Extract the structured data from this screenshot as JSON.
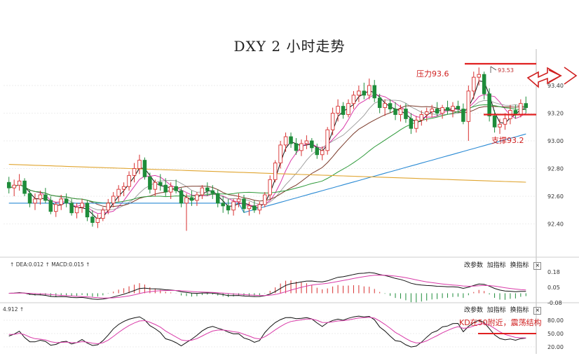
{
  "title": "DXY 2 小时走势",
  "colors": {
    "up": "#d83030",
    "down": "#1e8c3a",
    "ma_fast": "#111111",
    "ma_pink": "#d93aa8",
    "ma_gray": "#999999",
    "ma_brown": "#7a3a2a",
    "ma_green": "#2e9a3a",
    "ma_blue": "#2a8ad4",
    "ma_orange": "#e0a530",
    "annotation": "#e02020"
  },
  "main_panel": {
    "y_ticks": [
      "93.40",
      "93.20",
      "93.00",
      "92.80",
      "92.60",
      "92.40"
    ],
    "annotations": {
      "resistance_label": "压力93.6",
      "support_label": "支撑93.2",
      "peak_label": "93.53"
    }
  },
  "macd_panel": {
    "header": {
      "dea_label": "DEA:0.012",
      "macd_label": "MACD:0.015"
    },
    "y_ticks": [
      "0.18",
      "0.05",
      "-0.08"
    ],
    "buttons": [
      "改参数",
      "加指标",
      "换指标"
    ],
    "close": "×"
  },
  "kd_panel": {
    "header": {
      "value_label": "4.912"
    },
    "y_ticks": [
      "80.00",
      "50.00",
      "20.00"
    ],
    "buttons": [
      "改参数",
      "加指标",
      "换指标"
    ],
    "close": "×",
    "annotation": "KD在50附近，震荡结构"
  },
  "chart_data": {
    "type": "candlestick",
    "title": "DXY 2 小时走势",
    "ylim": [
      92.2,
      93.55
    ],
    "y_ticks": [
      92.4,
      92.6,
      92.8,
      93.0,
      93.2,
      93.4
    ],
    "resistance": 93.6,
    "support": 93.2,
    "peak_marker": 93.53,
    "ohlc": [
      [
        92.7,
        92.74,
        92.62,
        92.66
      ],
      [
        92.66,
        92.72,
        92.6,
        92.68
      ],
      [
        92.68,
        92.76,
        92.64,
        92.71
      ],
      [
        92.71,
        92.73,
        92.6,
        92.62
      ],
      [
        92.62,
        92.65,
        92.52,
        92.55
      ],
      [
        92.55,
        92.62,
        92.5,
        92.58
      ],
      [
        92.58,
        92.64,
        92.54,
        92.61
      ],
      [
        92.61,
        92.66,
        92.55,
        92.57
      ],
      [
        92.57,
        92.6,
        92.47,
        92.49
      ],
      [
        92.49,
        92.56,
        92.45,
        92.54
      ],
      [
        92.54,
        92.61,
        92.5,
        92.58
      ],
      [
        92.58,
        92.62,
        92.52,
        92.55
      ],
      [
        92.55,
        92.58,
        92.46,
        92.48
      ],
      [
        92.48,
        92.55,
        92.44,
        92.52
      ],
      [
        92.52,
        92.58,
        92.48,
        92.55
      ],
      [
        92.55,
        92.57,
        92.42,
        92.45
      ],
      [
        92.45,
        92.5,
        92.38,
        92.41
      ],
      [
        92.41,
        92.47,
        92.37,
        92.44
      ],
      [
        92.44,
        92.52,
        92.42,
        92.5
      ],
      [
        92.5,
        92.58,
        92.47,
        92.55
      ],
      [
        92.55,
        92.63,
        92.52,
        92.6
      ],
      [
        92.6,
        92.68,
        92.56,
        92.65
      ],
      [
        92.65,
        92.7,
        92.6,
        92.67
      ],
      [
        92.67,
        92.78,
        92.64,
        92.75
      ],
      [
        92.75,
        92.84,
        92.7,
        92.8
      ],
      [
        92.8,
        92.9,
        92.76,
        92.86
      ],
      [
        92.86,
        92.88,
        92.72,
        92.74
      ],
      [
        92.74,
        92.77,
        92.62,
        92.65
      ],
      [
        92.65,
        92.72,
        92.6,
        92.7
      ],
      [
        92.7,
        92.76,
        92.64,
        92.68
      ],
      [
        92.68,
        92.73,
        92.6,
        92.63
      ],
      [
        92.63,
        92.7,
        92.58,
        92.67
      ],
      [
        92.67,
        92.72,
        92.62,
        92.64
      ],
      [
        92.64,
        92.66,
        92.52,
        92.55
      ],
      [
        92.55,
        92.62,
        92.35,
        92.59
      ],
      [
        92.59,
        92.64,
        92.53,
        92.57
      ],
      [
        92.57,
        92.63,
        92.53,
        92.61
      ],
      [
        92.61,
        92.68,
        92.58,
        92.66
      ],
      [
        92.66,
        92.7,
        92.6,
        92.64
      ],
      [
        92.64,
        92.68,
        92.58,
        92.62
      ],
      [
        92.62,
        92.65,
        92.52,
        92.55
      ],
      [
        92.55,
        92.6,
        92.48,
        92.53
      ],
      [
        92.53,
        92.58,
        92.47,
        92.5
      ],
      [
        92.5,
        92.58,
        92.46,
        92.56
      ],
      [
        92.56,
        92.62,
        92.52,
        92.58
      ],
      [
        92.58,
        92.61,
        92.48,
        92.51
      ],
      [
        92.51,
        92.56,
        92.46,
        92.53
      ],
      [
        92.53,
        92.57,
        92.48,
        92.5
      ],
      [
        92.5,
        92.56,
        92.47,
        92.54
      ],
      [
        92.54,
        92.63,
        92.52,
        92.61
      ],
      [
        92.61,
        92.75,
        92.58,
        92.72
      ],
      [
        92.72,
        92.86,
        92.7,
        92.84
      ],
      [
        92.84,
        93.0,
        92.8,
        92.97
      ],
      [
        92.97,
        93.06,
        92.92,
        93.03
      ],
      [
        93.03,
        93.06,
        92.95,
        92.98
      ],
      [
        92.98,
        93.02,
        92.9,
        92.93
      ],
      [
        92.93,
        93.01,
        92.89,
        92.98
      ],
      [
        92.98,
        93.04,
        92.94,
        93.0
      ],
      [
        93.0,
        93.02,
        92.92,
        92.95
      ],
      [
        92.95,
        92.98,
        92.87,
        92.9
      ],
      [
        92.9,
        92.96,
        92.86,
        92.93
      ],
      [
        92.93,
        93.1,
        92.9,
        93.08
      ],
      [
        93.08,
        93.24,
        93.04,
        93.2
      ],
      [
        93.2,
        93.3,
        93.14,
        93.25
      ],
      [
        93.25,
        93.28,
        93.16,
        93.19
      ],
      [
        93.19,
        93.3,
        93.17,
        93.27
      ],
      [
        93.27,
        93.36,
        93.23,
        93.33
      ],
      [
        93.33,
        93.4,
        93.28,
        93.36
      ],
      [
        93.36,
        93.42,
        93.3,
        93.33
      ],
      [
        93.33,
        93.45,
        93.3,
        93.4
      ],
      [
        93.4,
        93.44,
        93.28,
        93.31
      ],
      [
        93.31,
        93.34,
        93.2,
        93.24
      ],
      [
        93.24,
        93.3,
        93.18,
        93.27
      ],
      [
        93.27,
        93.3,
        93.2,
        93.23
      ],
      [
        93.23,
        93.28,
        93.15,
        93.19
      ],
      [
        93.19,
        93.26,
        93.14,
        93.23
      ],
      [
        93.23,
        93.27,
        93.13,
        93.16
      ],
      [
        93.16,
        93.2,
        93.05,
        93.09
      ],
      [
        93.09,
        93.18,
        93.06,
        93.15
      ],
      [
        93.15,
        93.22,
        93.11,
        93.19
      ],
      [
        93.19,
        93.24,
        93.14,
        93.21
      ],
      [
        93.21,
        93.26,
        93.17,
        93.23
      ],
      [
        93.23,
        93.28,
        93.18,
        93.2
      ],
      [
        93.2,
        93.26,
        93.16,
        93.24
      ],
      [
        93.24,
        93.29,
        93.19,
        93.22
      ],
      [
        93.22,
        93.28,
        93.17,
        93.25
      ],
      [
        93.25,
        93.29,
        93.2,
        93.23
      ],
      [
        93.23,
        93.27,
        93.12,
        93.14
      ],
      [
        93.14,
        93.4,
        93.0,
        93.36
      ],
      [
        93.36,
        93.5,
        93.3,
        93.46
      ],
      [
        93.46,
        93.53,
        93.4,
        93.48
      ],
      [
        93.48,
        93.5,
        93.3,
        93.34
      ],
      [
        93.34,
        93.38,
        93.14,
        93.18
      ],
      [
        93.18,
        93.22,
        93.06,
        93.1
      ],
      [
        93.1,
        93.16,
        93.05,
        93.12
      ],
      [
        93.12,
        93.2,
        93.08,
        93.16
      ],
      [
        93.16,
        93.26,
        93.12,
        93.22
      ],
      [
        93.22,
        93.26,
        93.16,
        93.19
      ],
      [
        93.19,
        93.3,
        93.17,
        93.27
      ],
      [
        93.27,
        93.32,
        93.2,
        93.24
      ]
    ],
    "macd": {
      "y_ticks": [
        0.18,
        0.05,
        -0.08
      ],
      "ylim": [
        -0.1,
        0.2
      ]
    },
    "kd": {
      "y_ticks": [
        80,
        50,
        20
      ],
      "ylim": [
        10,
        95
      ]
    }
  }
}
